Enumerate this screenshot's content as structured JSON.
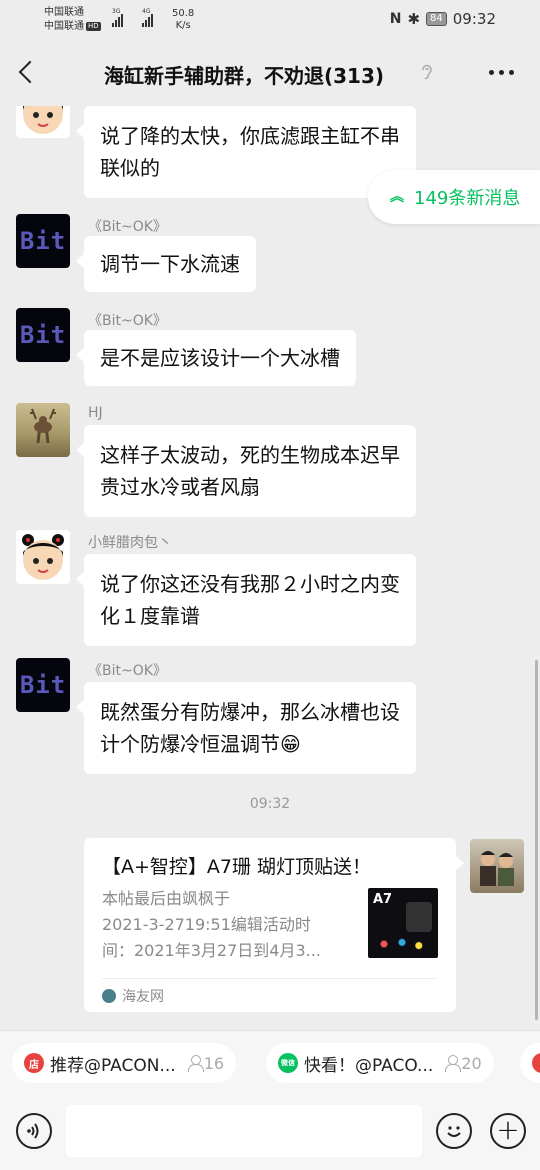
{
  "status_bar": {
    "carrier_1": "中国联通",
    "carrier_2": "中国联通",
    "hd": "HD",
    "net_1": "3G",
    "net_2": "4G",
    "speed_value": "50.8",
    "speed_unit": "K/s",
    "battery": "84",
    "time": "09:32"
  },
  "header": {
    "title": "海缸新手辅助群，不劝退(313)"
  },
  "new_messages": {
    "label": "149条新消息"
  },
  "messages": [
    {
      "sender": "",
      "text_lines": [
        "说了降的太快，你底滤跟主缸不串",
        "联似的"
      ]
    },
    {
      "sender": "《Bit~OK》",
      "text_lines": [
        "调节一下水流速"
      ],
      "avatar_text": "Bit"
    },
    {
      "sender": "《Bit~OK》",
      "text_lines": [
        "是不是应该设计一个大冰槽"
      ],
      "avatar_text": "Bit"
    },
    {
      "sender": "HJ",
      "text_lines": [
        "这样子太波动，死的生物成本迟早",
        "贵过水冷或者风扇"
      ]
    },
    {
      "sender": "小鲜腊肉包丶",
      "text_lines": [
        "说了你这还没有我那２小时之内变",
        "化１度靠谱"
      ]
    },
    {
      "sender": "《Bit~OK》",
      "text_lines": [
        "既然蛋分有防爆冲，那么冰槽也设",
        "计个防爆冷恒温调节😁"
      ],
      "avatar_text": "Bit"
    }
  ],
  "timestamp": "09:32",
  "link_card": {
    "title": "【A+智控】A7珊 瑚灯顶贴送！",
    "desc_lines": [
      "本帖最后由飒枫于",
      "2021-3-2719:51编辑活动时",
      "间：2021年3月27日到4月3..."
    ],
    "thumb_text": "A7",
    "source": "海友网"
  },
  "chips": [
    {
      "icon_text": "店",
      "label": "推荐@PACON...",
      "count": "16",
      "color": "#e64340"
    },
    {
      "icon_text": "微信",
      "label": "快看！@PACO...",
      "count": "20",
      "color": "#07c160"
    },
    {
      "icon_text": "",
      "label": "",
      "count": "",
      "color": "#e64340"
    }
  ],
  "input": {
    "placeholder": ""
  }
}
